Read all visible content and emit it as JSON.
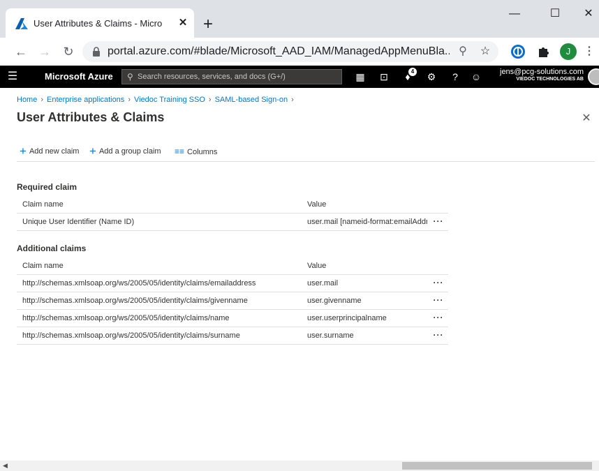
{
  "browser": {
    "tab_title": "User Attributes & Claims - Micro",
    "tab_close": "✕",
    "new_tab": "+",
    "window_buttons": {
      "minimize": "—",
      "maximize": "☐",
      "close": "✕"
    },
    "url": "portal.azure.com/#blade/Microsoft_AAD_IAM/ManagedAppMenuBla...",
    "profile_initial": "J"
  },
  "azure": {
    "brand": "Microsoft Azure",
    "search_placeholder": "Search resources, services, and docs (G+/)",
    "notification_count": "4",
    "user_email": "jens@pcg-solutions.com",
    "user_org": "VIEDOC TECHNOLOGIES AB"
  },
  "breadcrumb": [
    "Home",
    "Enterprise applications",
    "Viedoc Training SSO",
    "SAML-based Sign-on"
  ],
  "page_title": "User Attributes & Claims",
  "commands": {
    "add_new_claim": "Add new claim",
    "add_group_claim": "Add a group claim",
    "columns": "Columns"
  },
  "required": {
    "title": "Required claim",
    "col_name": "Claim name",
    "col_value": "Value",
    "rows": [
      {
        "name": "Unique User Identifier (Name ID)",
        "value": "user.mail [nameid-format:emailAddr..."
      }
    ]
  },
  "additional": {
    "title": "Additional claims",
    "col_name": "Claim name",
    "col_value": "Value",
    "rows": [
      {
        "name": "http://schemas.xmlsoap.org/ws/2005/05/identity/claims/emailaddress",
        "value": "user.mail"
      },
      {
        "name": "http://schemas.xmlsoap.org/ws/2005/05/identity/claims/givenname",
        "value": "user.givenname"
      },
      {
        "name": "http://schemas.xmlsoap.org/ws/2005/05/identity/claims/name",
        "value": "user.userprincipalname"
      },
      {
        "name": "http://schemas.xmlsoap.org/ws/2005/05/identity/claims/surname",
        "value": "user.surname"
      }
    ]
  },
  "more_glyph": "···",
  "colors": {
    "azure_blue": "#0078d4",
    "header_black": "#000000",
    "profile_green": "#1e8e3e"
  }
}
